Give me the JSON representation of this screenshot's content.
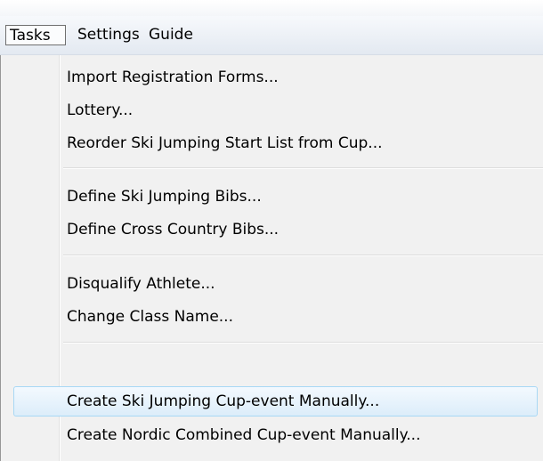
{
  "menubar": {
    "tasks_label": "Tasks",
    "settings_label": "Settings",
    "guide_label": "Guide"
  },
  "tasks_menu": {
    "items": [
      {
        "label": "Import Registration Forms..."
      },
      {
        "label": "Lottery..."
      },
      {
        "label": "Reorder Ski Jumping Start List from Cup..."
      },
      {
        "label": "Define Ski Jumping Bibs..."
      },
      {
        "label": "Define Cross Country Bibs..."
      },
      {
        "label": "Disqualify Athlete..."
      },
      {
        "label": "Change Class Name..."
      },
      {
        "label": "Create Ski Jumping Cup-event Manually..."
      },
      {
        "label": "Create Nordic Combined Cup-event Manually..."
      }
    ],
    "highlighted_item": "Create Ski Jumping Cup-event Manually..."
  },
  "colors": {
    "menu_background": "#f1f1f1",
    "highlight_border": "#a8d8f5",
    "highlight_fill": "#dcedfa",
    "menubar_background": "#e3e9f1"
  }
}
